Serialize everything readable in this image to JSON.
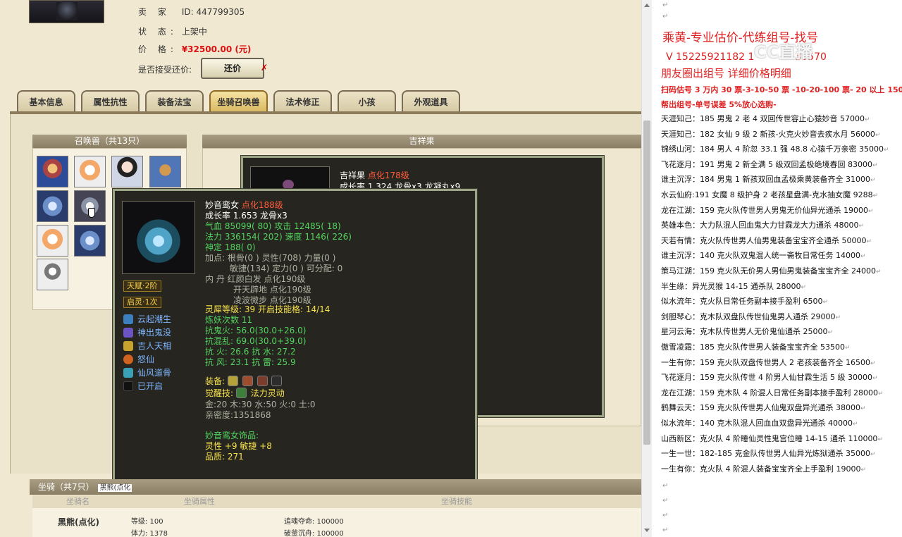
{
  "seller_section": {
    "seller_label": "卖 家",
    "seller_value": "ID: 447799305",
    "status_label": "状 态:",
    "status_value": "上架中",
    "price_label": "价 格:",
    "price_value": "¥32500.00 (元)",
    "counter_label": "是否接受还价:",
    "counter_button": "还价",
    "counter_mark": "✗"
  },
  "tabs": [
    "基本信息",
    "属性抗性",
    "装备法宝",
    "坐骑召唤兽",
    "法术修正",
    "小孩",
    "外观道具"
  ],
  "active_tab": "坐骑召唤兽",
  "summon_panel": {
    "title": "召唤兽（共13只）"
  },
  "right_panel": {
    "title": "吉祥果"
  },
  "tooltip_pet2": {
    "name": "吉祥果",
    "level": "点化178级",
    "growth": "成长率 1.324 龙骨x3 龙凝丸x9"
  },
  "tooltip_pet1": {
    "name": "妙音鸾女",
    "level": "点化188级",
    "growth": "成长率 1.653 龙骨x3",
    "hp": "气血 85099( 80) 攻击 12485( 18)",
    "mp": "法力 336154( 202) 速度 1146( 226)",
    "spirit": "神定 188( 0)",
    "points1": "加点:  根骨(0 ) 灵性(708) 力量(0 )",
    "points2": "敏捷(134) 定力(0 ) 可分配:  0",
    "neidan1": "内    丹  红颜白发 点化190级",
    "neidan2": "开天辟地 点化190级",
    "neidan3": "凌波微步 点化190级",
    "talent_badge": "天赋·2阶",
    "spirit_badge": "启灵·1次",
    "skills": [
      "云起潮生",
      "神出鬼没",
      "吉人天相",
      "怒仙",
      "仙风道骨",
      "已开启"
    ],
    "lingxi_label": "灵犀等级:",
    "lingxi_value": "39 开启技能格:  14/14",
    "refine": "炼妖次数 11",
    "res1": "抗鬼火: 56.0(30.0+26.0)",
    "res2": "抗混乱: 69.0(30.0+39.0)",
    "res3": "抗    火: 26.6 抗    水: 27.2",
    "res4": "抗    风: 23.1 抗    雷: 25.9",
    "equip_label": "装备:",
    "awaken_label": "觉醒技:",
    "awaken_value": "法力灵动",
    "element": "金:20 木:30 水:50 火:0 土:0",
    "intimacy": "亲密度:1351868",
    "ornament_title": "妙音鸾女饰品:",
    "ornament_attr": "灵性 +9 敏捷 +8",
    "ornament_quality": "品质: 271"
  },
  "mount_section": {
    "title": "坐骑（共7只）",
    "tag": "黑熊(点化",
    "columns": [
      "坐骑名",
      "坐骑属性",
      "坐骑技能"
    ],
    "name": "黑熊(点化)",
    "level": "等级: 100",
    "stamina": "体力: 1378",
    "skill1": "追魂夺命: 100000",
    "skill2": "破釜沉舟: 100000"
  },
  "doc": {
    "heading": "乘黄-专业估价-代练组号-找号",
    "phone": "V 15225921182   1",
    "phone_tail": "35570",
    "circle": "朋友圈出组号     详细价格明细",
    "scan_line": "扫码估号 3 万内 30 票-3-10-50 票  -10-20-100 票- 20 以上 150",
    "help_line": "帮出组号-单号误差 5%放心选购-",
    "watermark": "CC直播",
    "items": [
      "天涯知己：185 男鬼 2 老 4 双回传世容止心猿妙音 57000",
      "天涯知己：182 女仙 9 级 2 新孩-火克火妙音去疾水月 56000",
      "锦绣山河：184 男人 4 阶忽 33.1 强 48.8 心猿千万亲密 35000",
      "飞花逐月：191 男鬼 2 新全满 5 级双回孟极绝境春回 83000",
      "谁主沉浮：184 男鬼 1 新孩双回血孟极乘黄装备齐全 31000",
      "水云仙府:191 女魔 8 级护身 2 老孩星盘满-克水抽女魔 9288",
      "龙在江湖：159 克火队传世男人男鬼无价仙异光通杀 19000",
      "英雄本色：大力队混人回血鬼大力甘霖龙大力通杀 48000",
      "天若有情：克火队传世男人仙男鬼装备宝宝齐全通杀 50000",
      "谁主沉浮：140 克火队双鬼混人统一斋牧日常任务 14000",
      "策马江湖：159 克火队无价男人男仙男鬼装备宝宝齐全 24000",
      "半生缘：异光灵猴 14-15 通杀队 28000",
      "似水流年：克火队日常任务副本接手盈利 6500",
      "剑胆琴心：克木队双盘队传世仙鬼男人通杀 29000",
      "星河云海：克木队传世男人无价鬼仙通杀 25000",
      "傲雪凌霜：185 克火队传世男人装备宝宝齐全 53500",
      "一生有你：159 克火队双盘传世男人 2 老孩装备齐全 16500",
      "飞花逐月：159 克火队传世 4 阶男人仙甘霖生活 5 级 30000",
      "龙在江湖：159 克木队 4 阶混人日常任务副本接手盈利 28000",
      "鹤舞云天：159 克火队传世男人仙鬼双盘异光通杀 38000",
      "似水流年：140 克木队混人回血血双盘异光通杀 40000",
      "山西新区：克火队 4 阶睡仙灵性鬼宫位睡 14-15 通杀 110000",
      "一生一世：182-185 克金队传世男人仙异光炼狱通杀 35000",
      "一生有你：克火队 4 阶混人装备宝宝齐全上手盈利 19000"
    ],
    "return_mark": "↵"
  },
  "colors": {
    "doc_red": "#e02020",
    "tooltip_bg": "#26251f",
    "tooltip_green": "#52d45f",
    "tooltip_red": "#ff5b3b",
    "tooltip_yellow": "#f7e24d",
    "tooltip_blue": "#7cb4ff",
    "price_red": "#d11"
  }
}
